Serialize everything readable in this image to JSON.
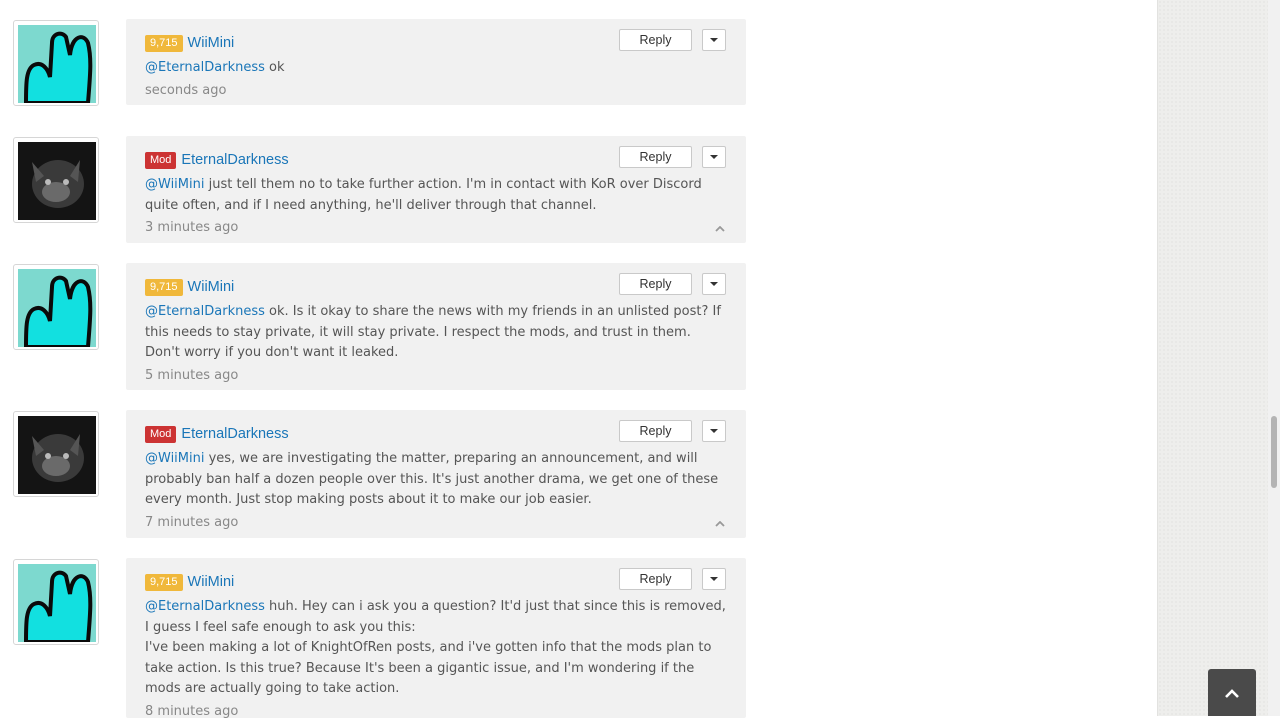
{
  "comments": [
    {
      "badge_type": "points",
      "badge": "9,715",
      "username": "WiiMini",
      "avatar": "wiimini-cyan-hand-avatar",
      "mention": "@EternalDarkness",
      "text": " ok",
      "extra": "",
      "time": "seconds ago",
      "reply": "Reply",
      "collapsible": false
    },
    {
      "badge_type": "mod",
      "badge": "Mod",
      "username": "EternalDarkness",
      "avatar": "eternaldarkness-dark-wolf-avatar",
      "mention": "@WiiMini",
      "text": " just tell them no to take further action. I'm in contact with KoR over Discord quite often, and if I need anything, he'll deliver through that channel.",
      "extra": "",
      "time": "3 minutes ago",
      "reply": "Reply",
      "collapsible": true
    },
    {
      "badge_type": "points",
      "badge": "9,715",
      "username": "WiiMini",
      "avatar": "wiimini-cyan-hand-avatar",
      "mention": "@EternalDarkness",
      "text": " ok. Is it okay to share the news with my friends in an unlisted post? If this needs to stay private, it will stay private. I respect the mods, and trust in them. Don't worry if you don't want it leaked.",
      "extra": "",
      "time": "5 minutes ago",
      "reply": "Reply",
      "collapsible": false
    },
    {
      "badge_type": "mod",
      "badge": "Mod",
      "username": "EternalDarkness",
      "avatar": "eternaldarkness-dark-wolf-avatar",
      "mention": "@WiiMini",
      "text": " yes, we are investigating the matter, preparing an announcement, and will probably ban half a dozen people over this. It's just another drama, we get one of these every month. Just stop making posts about it to make our job easier.",
      "extra": "",
      "time": "7 minutes ago",
      "reply": "Reply",
      "collapsible": true
    },
    {
      "badge_type": "points",
      "badge": "9,715",
      "username": "WiiMini",
      "avatar": "wiimini-cyan-hand-avatar",
      "mention": "@EternalDarkness",
      "text": " huh. Hey can i ask you a question? It'd just that since this is removed, I guess I feel safe enough to ask you this:",
      "extra": "I've been making a lot of KnightOfRen posts, and i've gotten info that the mods plan to take action. Is this true? Because It's been a gigantic issue, and I'm wondering if the mods are actually going to take action.",
      "time": "8 minutes ago",
      "reply": "Reply",
      "collapsible": false
    }
  ],
  "back_to_top_icon": "chevron-up-icon",
  "colors": {
    "points_badge": "#f0b83b",
    "mod_badge": "#cc3333",
    "link": "#1a76b8",
    "bubble": "#f1f1f1"
  }
}
